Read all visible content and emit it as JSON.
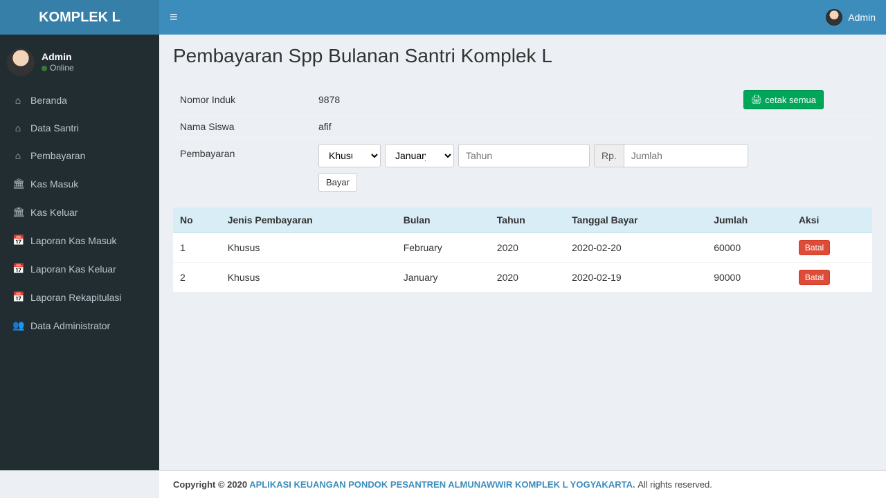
{
  "brand": "KOMPLEK L",
  "header": {
    "user": "Admin"
  },
  "sidebar": {
    "user": {
      "name": "Admin",
      "status": "Online"
    },
    "items": [
      {
        "icon": "⌂",
        "label": "Beranda"
      },
      {
        "icon": "⌂",
        "label": "Data Santri"
      },
      {
        "icon": "⌂",
        "label": "Pembayaran"
      },
      {
        "icon": "🏛",
        "label": "Kas Masuk"
      },
      {
        "icon": "🏛",
        "label": "Kas Keluar"
      },
      {
        "icon": "📅",
        "label": "Laporan Kas Masuk"
      },
      {
        "icon": "📅",
        "label": "Laporan Kas Keluar"
      },
      {
        "icon": "📅",
        "label": "Laporan Rekapitulasi"
      },
      {
        "icon": "👥",
        "label": "Data Administrator"
      }
    ]
  },
  "page": {
    "title": "Pembayaran Spp Bulanan Santri Komplek L",
    "labels": {
      "nomor_induk": "Nomor Induk",
      "nama_siswa": "Nama Siswa",
      "pembayaran": "Pembayaran"
    },
    "values": {
      "nomor_induk": "9878",
      "nama_siswa": "afif"
    },
    "buttons": {
      "cetak": "cetak semua",
      "bayar": "Bayar"
    },
    "form": {
      "jenis_selected": "Khusus",
      "bulan_selected": "January",
      "tahun_placeholder": "Tahun",
      "jumlah_prefix": "Rp.",
      "jumlah_placeholder": "Jumlah"
    }
  },
  "table": {
    "headers": [
      "No",
      "Jenis Pembayaran",
      "Bulan",
      "Tahun",
      "Tanggal Bayar",
      "Jumlah",
      "Aksi"
    ],
    "rows": [
      {
        "no": "1",
        "jenis": "Khusus",
        "bulan": "February",
        "tahun": "2020",
        "tanggal": "2020-02-20",
        "jumlah": "60000",
        "aksi": "Batal"
      },
      {
        "no": "2",
        "jenis": "Khusus",
        "bulan": "January",
        "tahun": "2020",
        "tanggal": "2020-02-19",
        "jumlah": "90000",
        "aksi": "Batal"
      }
    ]
  },
  "footer": {
    "copyright": "Copyright © 2020 ",
    "link": "APLIKASI KEUANGAN PONDOK PESANTREN ALMUNAWWIR KOMPLEK L YOGYAKARTA.",
    "rights": " All rights reserved."
  }
}
